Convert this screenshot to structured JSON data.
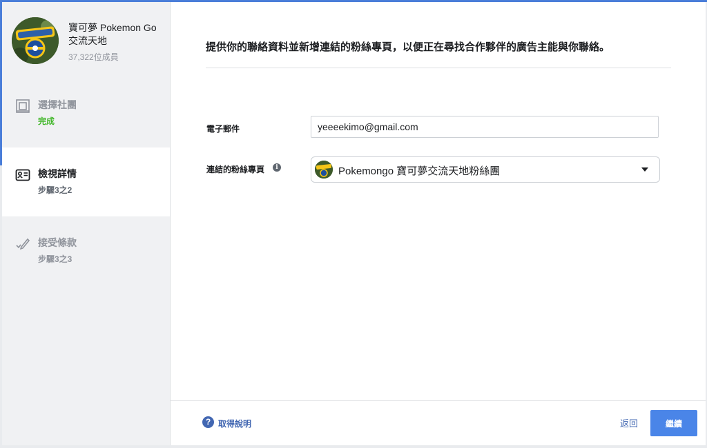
{
  "sidebar": {
    "group": {
      "name": "寶可夢 Pokemon Go 交流天地",
      "members": "37,322位成員",
      "avatar_icon": "pokemon-go-logo"
    },
    "steps": [
      {
        "title": "選擇社團",
        "status": "完成",
        "icon": "group-select-icon",
        "state": "done"
      },
      {
        "title": "檢視詳情",
        "status": "步驟3之2",
        "icon": "id-card-icon",
        "state": "active"
      },
      {
        "title": "接受條款",
        "status": "步驟3之3",
        "icon": "pen-check-icon",
        "state": "pending"
      }
    ]
  },
  "main": {
    "heading": "提供你的聯絡資料並新增連結的粉絲專頁，以便正在尋找合作夥伴的廣告主能與你聯絡。",
    "email": {
      "label": "電子郵件",
      "value": "yeeeekimo@gmail.com"
    },
    "page": {
      "label": "連結的粉絲專頁",
      "info_icon": "info-icon",
      "value": "Pokemongo 寶可夢交流天地粉絲團"
    }
  },
  "footer": {
    "help": "取得說明",
    "back": "返回",
    "continue": "繼續"
  },
  "colors": {
    "accent": "#4a85e8",
    "link": "#4267b2",
    "success": "#42b72a"
  }
}
